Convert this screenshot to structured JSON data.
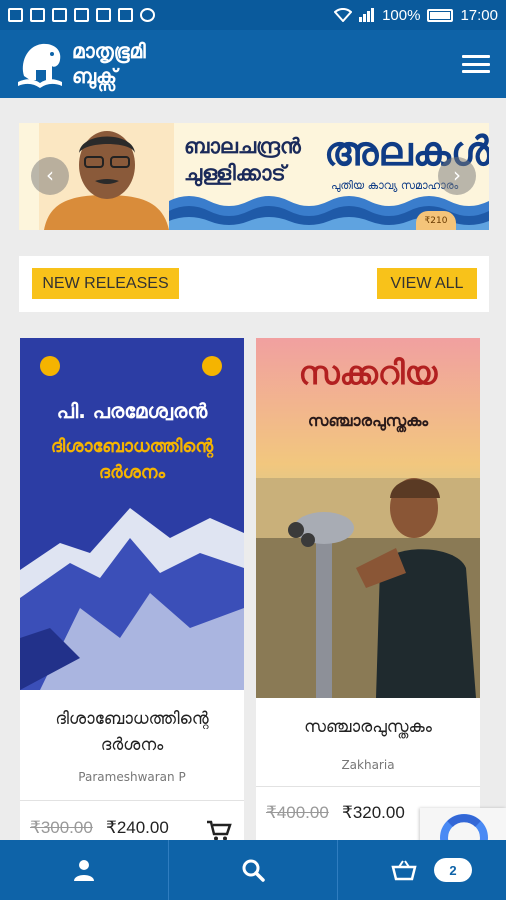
{
  "status_bar": {
    "battery_percent": "100%",
    "time": "17:00",
    "left_icons": [
      "mail-icon",
      "gmail-icon",
      "delete-icon",
      "message-icon",
      "download-icon",
      "usb-icon",
      "dnd-icon"
    ],
    "right_icons": [
      "wifi-icon",
      "signal-icon",
      "battery-icon"
    ]
  },
  "header": {
    "logo_line1": "മാതൃഭൂമി",
    "logo_line2": "ബുക്സ്",
    "menu_icon": "hamburger-menu-icon",
    "background": "#0e63a8"
  },
  "banner": {
    "author_line1": "ബാലചന്ദ്രൻ",
    "author_line2": "ചുള്ളിക്കാട്",
    "book_title": "അലകൾ",
    "book_subtitle": "പുതിയ കാവ്യ സമാഹാരം",
    "price": "₹210",
    "prev_label": "‹",
    "next_label": "›"
  },
  "section": {
    "new_releases_label": "NEW RELEASES",
    "view_all_label": "VIEW ALL",
    "accent": "#f8c21a"
  },
  "products": [
    {
      "cover_author": "പി. പരമേശ്വരൻ",
      "cover_title": "ദിശാബോധത്തിന്റെ ദർശനം",
      "title_line1": "ദിശാബോധത്തിന്റെ",
      "title_line2": "ദർശനം",
      "author": "Parameshwaran P",
      "price_old": "₹300.00",
      "price_new": "₹240.00"
    },
    {
      "cover_author": "സക്കറിയ",
      "cover_title": "സഞ്ചാരപുസ്തകം",
      "title_line1": "സഞ്ചാരപുസ്തകം",
      "author": "Zakharia",
      "price_old": "₹400.00",
      "price_new": "₹320.00"
    }
  ],
  "bottom_nav": {
    "items": [
      "user-icon",
      "search-icon",
      "cart-icon"
    ],
    "cart_count": "2"
  }
}
